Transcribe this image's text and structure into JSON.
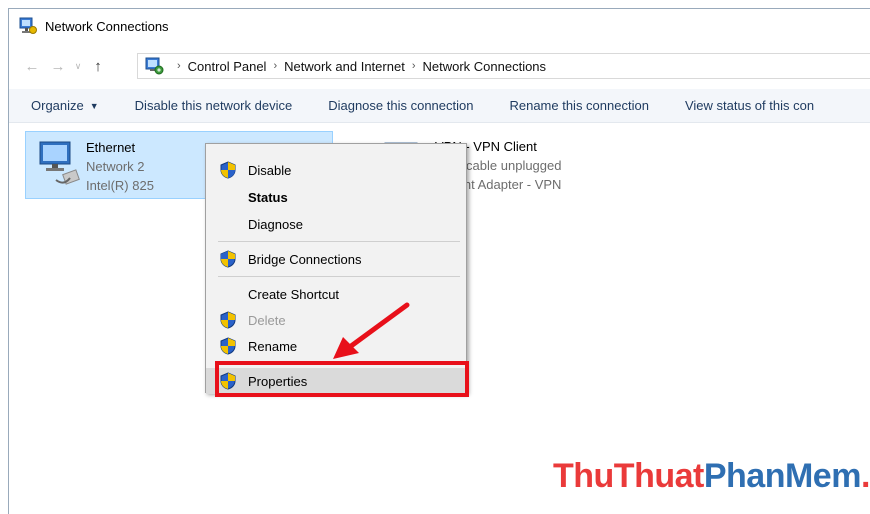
{
  "window": {
    "title": "Network Connections"
  },
  "address": {
    "back_icon": "back-arrow-icon",
    "forward_icon": "forward-arrow-icon",
    "up_icon": "up-arrow-icon",
    "crumbs": [
      "Control Panel",
      "Network and Internet",
      "Network Connections"
    ]
  },
  "toolbar": {
    "organize": "Organize",
    "disable": "Disable this network device",
    "diagnose": "Diagnose this connection",
    "rename": "Rename this connection",
    "view_status": "View status of this con"
  },
  "connections": [
    {
      "name": "Ethernet",
      "line2": "Network  2",
      "line3": "Intel(R) 825"
    },
    {
      "name": "VPN - VPN Client",
      "line2": "work cable unplugged",
      "line3": "l Client Adapter - VPN"
    }
  ],
  "context_menu": {
    "disable": "Disable",
    "status": "Status",
    "diagnose": "Diagnose",
    "bridge": "Bridge Connections",
    "shortcut": "Create Shortcut",
    "delete": "Delete",
    "rename": "Rename",
    "properties": "Properties"
  },
  "watermark": {
    "part1": "ThuThuat",
    "part2": "PhanMem",
    "part3": ".vn"
  },
  "colors": {
    "selection": "#cce8ff",
    "highlight_box": "#e8101a",
    "arrow": "#e8101a"
  }
}
